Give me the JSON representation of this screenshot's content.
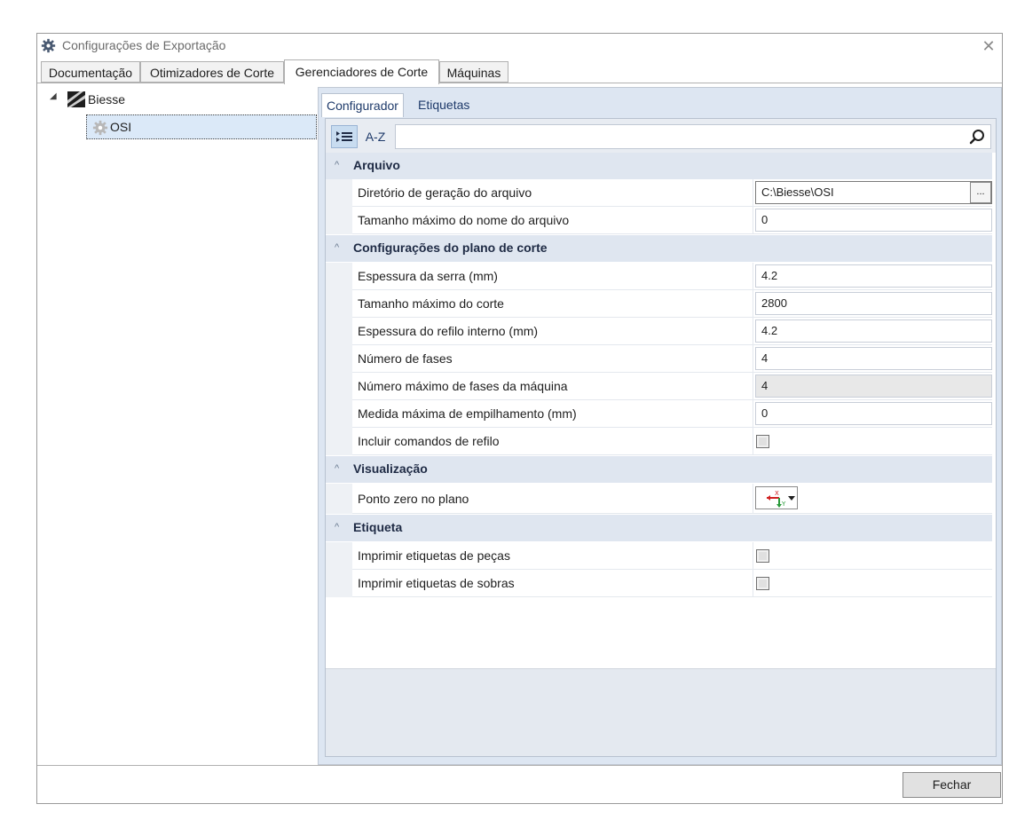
{
  "window": {
    "title": "Configurações de Exportação",
    "close_symbol": "✕"
  },
  "outer_tabs": [
    {
      "label": "Documentação",
      "active": false
    },
    {
      "label": "Otimizadores de Corte",
      "active": false
    },
    {
      "label": "Gerenciadores de Corte",
      "active": true
    },
    {
      "label": "Máquinas",
      "active": false
    }
  ],
  "tree": {
    "root": {
      "label": "Biesse",
      "expander": "◢",
      "icon": "biesse-logo-icon"
    },
    "child": {
      "label": "OSI",
      "icon": "gear-icon"
    }
  },
  "inner_tabs": [
    {
      "label": "Configurador",
      "active": true
    },
    {
      "label": "Etiquetas",
      "active": false
    }
  ],
  "toolbar": {
    "categorized_icon": "categorized-list-icon",
    "az_label": "A-Z",
    "search_placeholder": "",
    "search_icon": "search-icon"
  },
  "categories": [
    {
      "label": "Arquivo",
      "properties": [
        {
          "name": "Diretório de geração do arquivo",
          "value": "C:\\Biesse\\OSI",
          "type": "path",
          "button_label": "..."
        },
        {
          "name": "Tamanho máximo do nome do arquivo",
          "value": "0",
          "type": "text"
        }
      ]
    },
    {
      "label": "Configurações do plano de corte",
      "properties": [
        {
          "name": "Espessura da serra (mm)",
          "value": "4.2",
          "type": "text"
        },
        {
          "name": "Tamanho máximo do corte",
          "value": "2800",
          "type": "text"
        },
        {
          "name": "Espessura do refilo interno (mm)",
          "value": "4.2",
          "type": "text"
        },
        {
          "name": "Número de fases",
          "value": "4",
          "type": "text"
        },
        {
          "name": "Número máximo de fases da máquina",
          "value": "4",
          "type": "disabled"
        },
        {
          "name": "Medida máxima de empilhamento (mm)",
          "value": "0",
          "type": "text"
        },
        {
          "name": "Incluir comandos de refilo",
          "value": false,
          "type": "checkbox"
        }
      ]
    },
    {
      "label": "Visualização",
      "properties": [
        {
          "name": "Ponto zero no plano",
          "type": "axis-dropdown",
          "axis_x": "X",
          "axis_y": "Y"
        }
      ]
    },
    {
      "label": "Etiqueta",
      "properties": [
        {
          "name": "Imprimir etiquetas de peças",
          "value": false,
          "type": "checkbox"
        },
        {
          "name": "Imprimir etiquetas de sobras",
          "value": false,
          "type": "checkbox"
        }
      ]
    }
  ],
  "footer": {
    "close_button": "Fechar"
  },
  "colors": {
    "annotation_arrow": "#e8141c",
    "selection": "#dbe9f8",
    "category_bg": "#dfe6f0"
  }
}
